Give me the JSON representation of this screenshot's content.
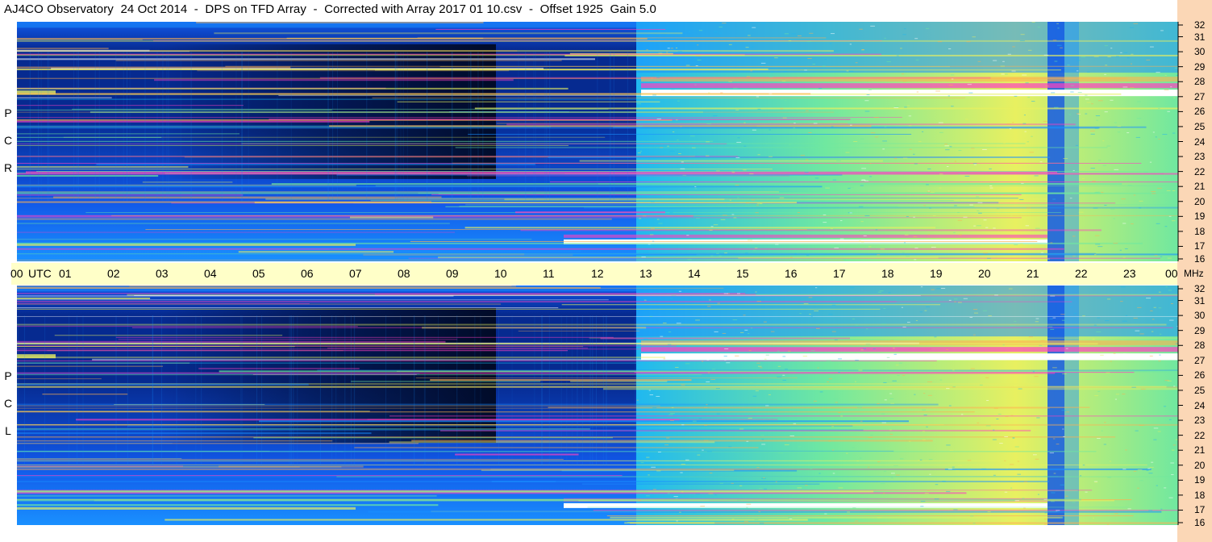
{
  "title": "AJ4CO Observatory  24 Oct 2014  -  DPS on TFD Array  -  Corrected with Array 2017 01 10.csv  -  Offset 1925  Gain 5.0",
  "panels": [
    {
      "id": "rcp",
      "label_letters": [
        "R",
        "C",
        "P"
      ]
    },
    {
      "id": "lcp",
      "label_letters": [
        "L",
        "C",
        "P"
      ]
    }
  ],
  "time_axis": {
    "start_label": "00",
    "unit_label": "UTC",
    "hours": [
      "01",
      "02",
      "03",
      "04",
      "05",
      "06",
      "07",
      "08",
      "09",
      "10",
      "11",
      "12",
      "13",
      "14",
      "15",
      "16",
      "17",
      "18",
      "19",
      "20",
      "21",
      "22",
      "23"
    ],
    "end_label": "00",
    "freq_unit": "MHz"
  },
  "freq_ticks": [
    "32",
    "31",
    "30",
    "29",
    "28",
    "27",
    "26",
    "25",
    "24",
    "23",
    "22",
    "21",
    "20",
    "19",
    "18",
    "17",
    "16"
  ],
  "colors": {
    "deep": "#00071c",
    "dark_blue": "#062a90",
    "mid_blue": "#1158e8",
    "light_blue": "#1a90ff",
    "cyan": "#20b8f0",
    "green": "#70e8a0",
    "yellow": "#e8f060",
    "orange": "#ffb050",
    "magenta": "#ff40c0",
    "white": "#ffffff",
    "axis_bg": "#ffffc8",
    "strip_bg": "#fbd7b6"
  },
  "chart_data": {
    "type": "heatmap",
    "x_unit": "UTC hour",
    "xlim": [
      0,
      24
    ],
    "y_unit": "MHz",
    "ylim": [
      16,
      32
    ],
    "series": [
      {
        "name": "RCP"
      },
      {
        "name": "LCP"
      }
    ],
    "features": [
      {
        "label": "night quiet band",
        "x_range": [
          0,
          12.8
        ]
      },
      {
        "label": "day noise",
        "x_range": [
          12.8,
          24
        ]
      },
      {
        "label": "strong signal",
        "freq_mhz": 27.2
      },
      {
        "label": "strong signal",
        "freq_mhz": 17.2
      },
      {
        "label": "quiet column",
        "x_range": [
          21.3,
          21.6
        ]
      }
    ]
  }
}
